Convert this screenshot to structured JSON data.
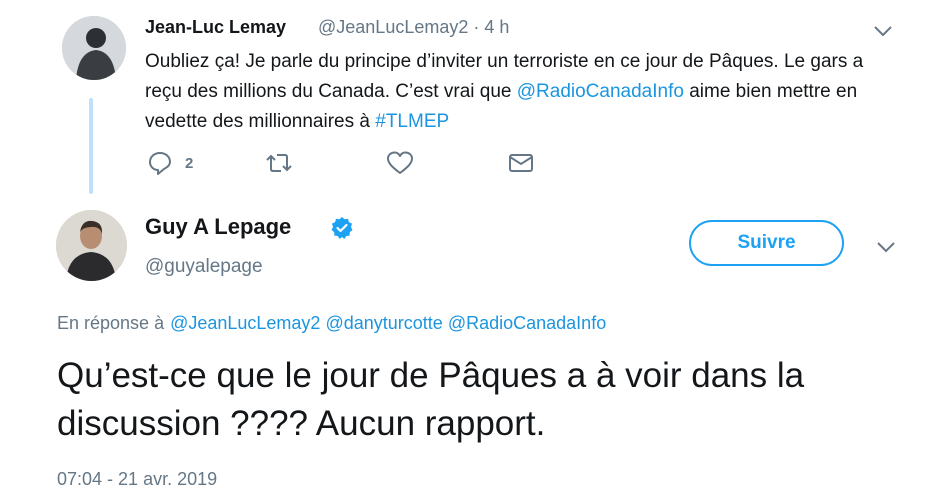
{
  "reply_tweet": {
    "author_name": "Jean-Luc Lemay",
    "author_handle": "@JeanLucLemay2",
    "time_ago": "· 4 h",
    "text_parts": [
      "Oubliez ça! Je parle du principe d’inviter un terroriste en ce jour de Pâques. Le gars a reçu des millions du Canada. C’est vrai que ",
      "@RadioCanadaInfo",
      " aime bien mettre en vedette des millionnaires à ",
      "#TLMEP"
    ],
    "actions": {
      "reply_count": "2",
      "retweet_count": "",
      "like_count": ""
    },
    "icons": [
      "reply-icon",
      "retweet-icon",
      "like-icon",
      "message-icon",
      "chevron-down-icon"
    ]
  },
  "main_tweet": {
    "author_name": "Guy A Lepage",
    "author_handle": "@guyalepage",
    "verified": true,
    "follow_label": "Suivre",
    "reply_to_label": "En réponse à",
    "reply_to_handles": [
      "@JeanLucLemay2",
      "@danyturcotte",
      "@RadioCanadaInfo"
    ],
    "text": "Qu’est-ce que le jour de Pâques a à voir dans la discussion ???? Aucun rapport.",
    "timestamp": "07:04 - 21 avr. 2019"
  },
  "colors": {
    "link": "#1b95e0",
    "accent": "#1da1f2",
    "muted": "#657786",
    "thread_line": "#bfe0f8"
  }
}
